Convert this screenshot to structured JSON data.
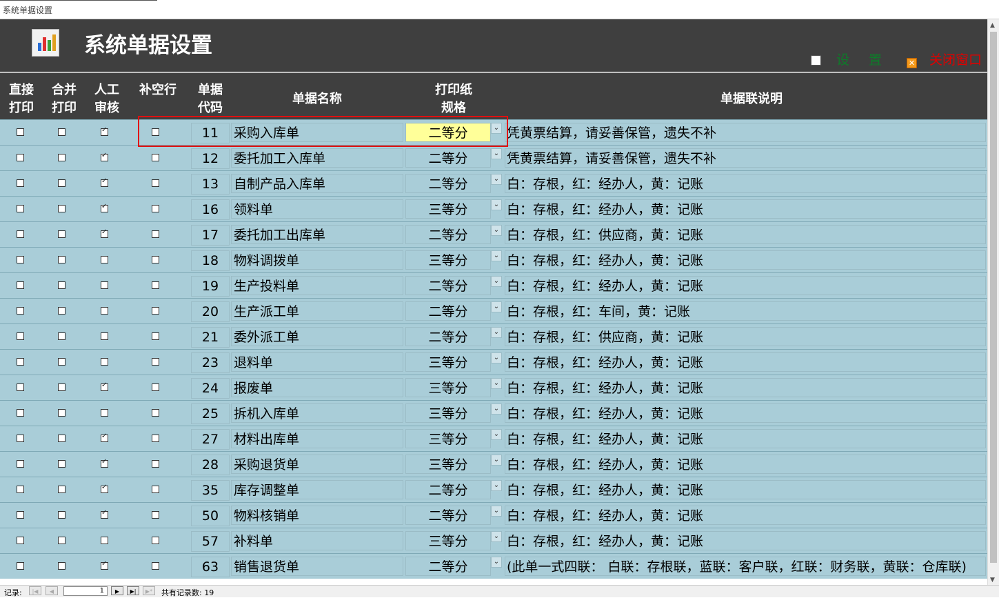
{
  "window": {
    "title": "系统单据设置"
  },
  "header": {
    "title": "系统单据设置",
    "settings_label": "设置",
    "close_label": "关闭窗口"
  },
  "columns": {
    "direct_print": [
      "直接",
      "打印"
    ],
    "merge_print": [
      "合并",
      "打印"
    ],
    "manual_review": [
      "人工",
      "审核"
    ],
    "fill_blank": [
      "补空行"
    ],
    "code": [
      "单据",
      "代码"
    ],
    "name": [
      "单据名称"
    ],
    "paper": [
      "打印纸",
      "规格"
    ],
    "desc": [
      "单据联说明"
    ]
  },
  "rows": [
    {
      "direct": false,
      "merge": false,
      "manual": true,
      "fill": false,
      "code": "11",
      "name": "采购入库单",
      "paper": "二等分",
      "desc": "凭黄票结算，请妥善保管，遗失不补"
    },
    {
      "direct": false,
      "merge": false,
      "manual": true,
      "fill": false,
      "code": "12",
      "name": "委托加工入库单",
      "paper": "二等分",
      "desc": "凭黄票结算，请妥善保管，遗失不补"
    },
    {
      "direct": false,
      "merge": false,
      "manual": true,
      "fill": false,
      "code": "13",
      "name": "自制产品入库单",
      "paper": "二等分",
      "desc": "白：存根，红：经办人，黄：记账"
    },
    {
      "direct": false,
      "merge": false,
      "manual": true,
      "fill": false,
      "code": "16",
      "name": "领料单",
      "paper": "三等分",
      "desc": "白：存根，红：经办人，黄：记账"
    },
    {
      "direct": false,
      "merge": false,
      "manual": true,
      "fill": false,
      "code": "17",
      "name": "委托加工出库单",
      "paper": "二等分",
      "desc": "白：存根，红：供应商，黄：记账"
    },
    {
      "direct": false,
      "merge": false,
      "manual": false,
      "fill": false,
      "code": "18",
      "name": "物料调拨单",
      "paper": "三等分",
      "desc": "白：存根，红：经办人，黄：记账"
    },
    {
      "direct": false,
      "merge": false,
      "manual": false,
      "fill": false,
      "code": "19",
      "name": "生产投料单",
      "paper": "二等分",
      "desc": "白：存根，红：经办人，黄：记账"
    },
    {
      "direct": false,
      "merge": false,
      "manual": false,
      "fill": false,
      "code": "20",
      "name": "生产派工单",
      "paper": "二等分",
      "desc": "白：存根，红：车间，黄：记账"
    },
    {
      "direct": false,
      "merge": false,
      "manual": false,
      "fill": false,
      "code": "21",
      "name": "委外派工单",
      "paper": "二等分",
      "desc": "白：存根，红：供应商，黄：记账"
    },
    {
      "direct": false,
      "merge": false,
      "manual": false,
      "fill": false,
      "code": "23",
      "name": "退料单",
      "paper": "三等分",
      "desc": "白：存根，红：经办人，黄：记账"
    },
    {
      "direct": false,
      "merge": false,
      "manual": true,
      "fill": false,
      "code": "24",
      "name": "报废单",
      "paper": "三等分",
      "desc": "白：存根，红：经办人，黄：记账"
    },
    {
      "direct": false,
      "merge": false,
      "manual": false,
      "fill": false,
      "code": "25",
      "name": "拆机入库单",
      "paper": "三等分",
      "desc": "白：存根，红：经办人，黄：记账"
    },
    {
      "direct": false,
      "merge": false,
      "manual": true,
      "fill": false,
      "code": "27",
      "name": "材料出库单",
      "paper": "三等分",
      "desc": "白：存根，红：经办人，黄：记账"
    },
    {
      "direct": false,
      "merge": false,
      "manual": true,
      "fill": false,
      "code": "28",
      "name": "采购退货单",
      "paper": "三等分",
      "desc": "白：存根，红：经办人，黄：记账"
    },
    {
      "direct": false,
      "merge": false,
      "manual": true,
      "fill": false,
      "code": "35",
      "name": "库存调整单",
      "paper": "二等分",
      "desc": "白：存根，红：经办人，黄：记账"
    },
    {
      "direct": false,
      "merge": false,
      "manual": true,
      "fill": false,
      "code": "50",
      "name": "物料核销单",
      "paper": "二等分",
      "desc": "白：存根，红：经办人，黄：记账"
    },
    {
      "direct": false,
      "merge": false,
      "manual": false,
      "fill": false,
      "code": "57",
      "name": "补料单",
      "paper": "三等分",
      "desc": "白：存根，红：经办人，黄：记账"
    },
    {
      "direct": false,
      "merge": false,
      "manual": true,
      "fill": false,
      "code": "63",
      "name": "销售退货单",
      "paper": "二等分",
      "desc": " (此单一式四联：  白联：存根联，蓝联：客户联，红联：财务联，黄联：仓库联)"
    }
  ],
  "navigation": {
    "label": "记录:",
    "current": "1",
    "total_text": "共有记录数: 19"
  },
  "colors": {
    "header_bg": "#3f3f3f",
    "row_bg": "#a9cdd8",
    "selected_field": "#ffff99",
    "highlight_border": "#e01010"
  }
}
